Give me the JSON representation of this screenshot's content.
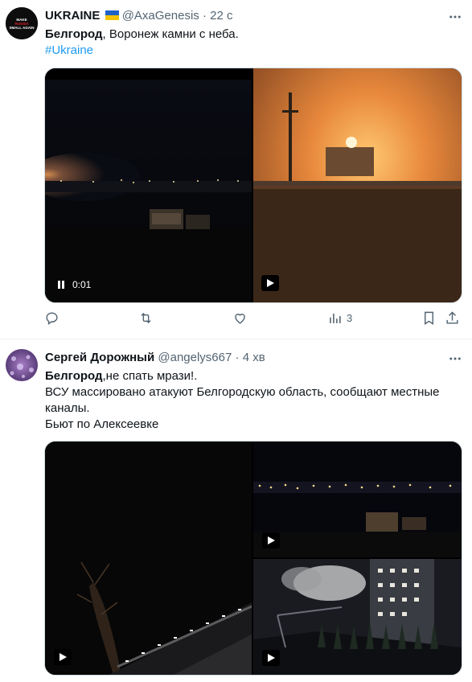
{
  "tweet1": {
    "author_name": "UKRAINE",
    "flag_colors": [
      "#1e62c9",
      "#f5c400"
    ],
    "handle": "@AxaGenesis",
    "separator": "·",
    "time": "22 с",
    "avatar_lines": [
      "MAKE",
      "RUSSIA",
      "SMALL AGAIN"
    ],
    "text_bold": "Белгород",
    "text_rest": ", Воронеж камни с неба.",
    "hashtag": "#Ukraine",
    "video_time": "0:01",
    "views_count": "3"
  },
  "tweet2": {
    "author_name": "Сергей Дорожный",
    "handle": "@angelys667",
    "separator": "·",
    "time": "4 хв",
    "text_bold": "Белгород",
    "text_line1_rest": ",не спать мрази!.",
    "text_line2": "ВСУ массировано атакуют Белгородскую область, сообщают местные",
    "text_line3": "каналы.",
    "text_line4": "Бьют по Алексеевке"
  },
  "icons": [
    "more-icon",
    "reply-icon",
    "retweet-icon",
    "like-icon",
    "views-icon",
    "bookmark-icon",
    "share-icon",
    "play-icon",
    "pause-icon"
  ]
}
